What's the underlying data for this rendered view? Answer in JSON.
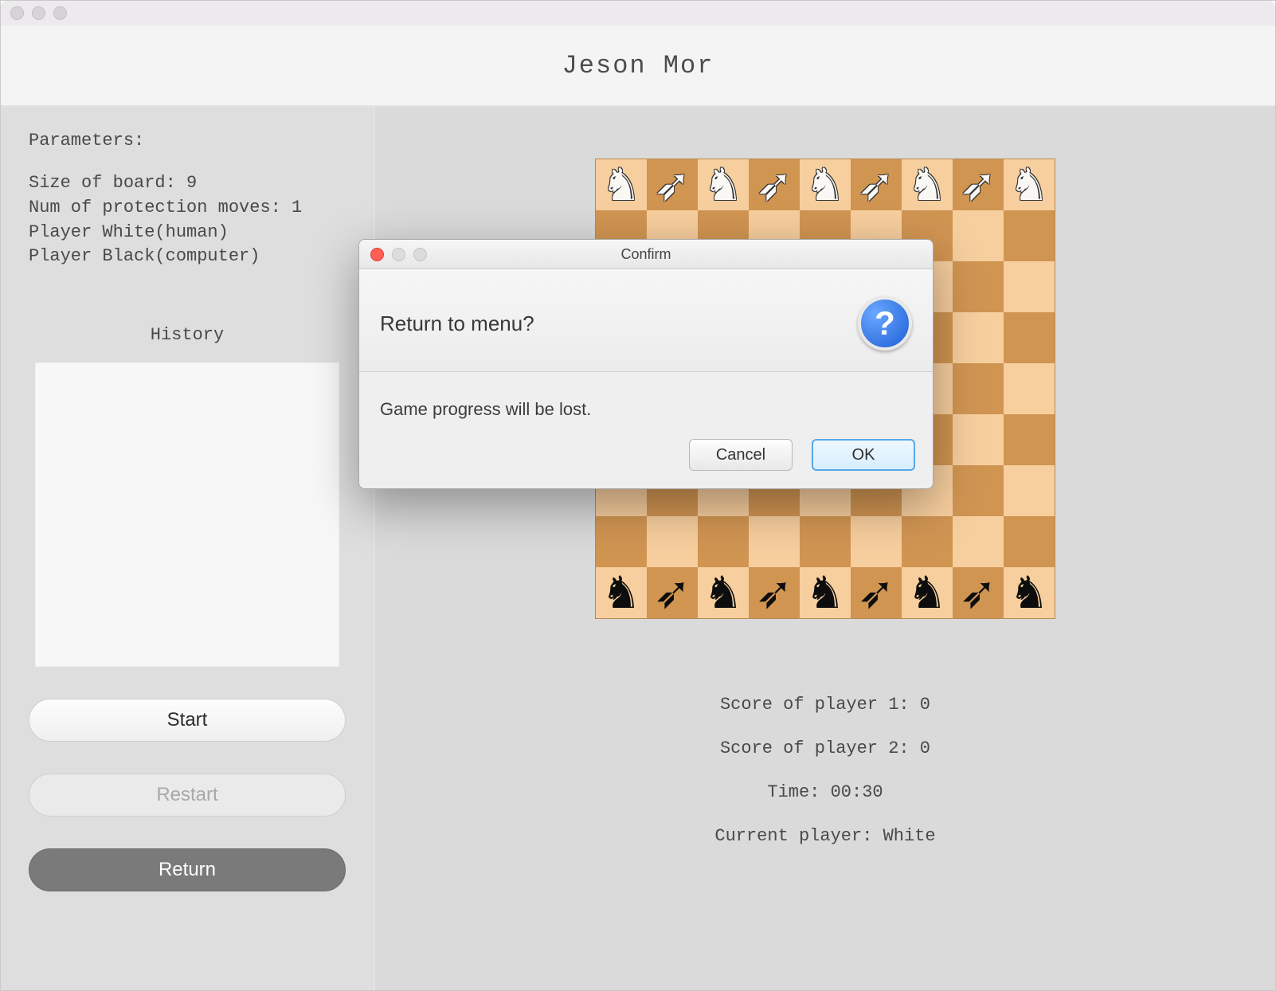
{
  "app_title": "Jeson Mor",
  "sidebar": {
    "heading": "Parameters:",
    "lines": [
      "Size of board: 9",
      "Num of protection moves: 1",
      "Player White(human)",
      "Player Black(computer)"
    ],
    "history_heading": "History",
    "buttons": {
      "start": "Start",
      "restart": "Restart",
      "return": "Return"
    }
  },
  "board": {
    "size": 9,
    "top_pieces": [
      "knight",
      "archer",
      "knight",
      "archer",
      "knight",
      "archer",
      "knight",
      "archer",
      "knight"
    ],
    "bottom_pieces": [
      "knight",
      "archer",
      "knight",
      "archer",
      "knight",
      "archer",
      "knight",
      "archer",
      "knight"
    ]
  },
  "status": {
    "score1": "Score of player 1: 0",
    "score2": "Score of player 2: 0",
    "time": "Time: 00:30",
    "current": "Current player: White"
  },
  "dialog": {
    "window_title": "Confirm",
    "title": "Return to menu?",
    "body": "Game progress will be lost.",
    "cancel": "Cancel",
    "ok": "OK"
  }
}
